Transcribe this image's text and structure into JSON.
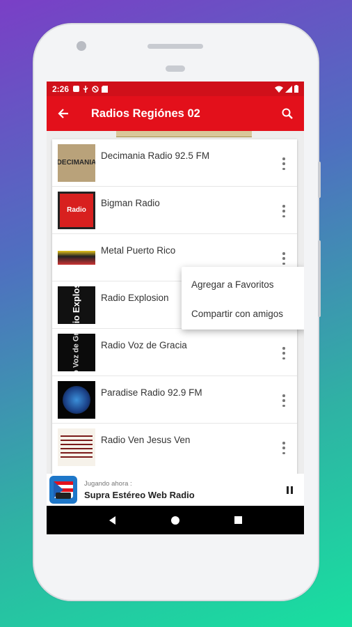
{
  "status_bar": {
    "time": "2:26"
  },
  "app_bar": {
    "title": "Radios Regiónes 02"
  },
  "stations": [
    {
      "name": "Decimania Radio 92.5 FM",
      "thumb_text": "DECIMANIA"
    },
    {
      "name": "Bigman Radio",
      "thumb_text": "Radio"
    },
    {
      "name": "Metal Puerto Rico",
      "thumb_text": ""
    },
    {
      "name": "Radio Explosion",
      "thumb_text": "dio Explosi"
    },
    {
      "name": "Radio Voz de Gracia",
      "thumb_text": "io Voz de Gra"
    },
    {
      "name": "Paradise Radio 92.9 FM",
      "thumb_text": ""
    },
    {
      "name": "Radio Ven Jesus Ven",
      "thumb_text": ""
    }
  ],
  "context_menu": {
    "items": [
      "Agregar a Favoritos",
      "Compartir con amigos"
    ]
  },
  "player": {
    "now_playing_label": "Jugando ahora :",
    "station": "Supra Estéreo Web Radio"
  },
  "colors": {
    "primary": "#e3101b",
    "status": "#d0101a"
  }
}
